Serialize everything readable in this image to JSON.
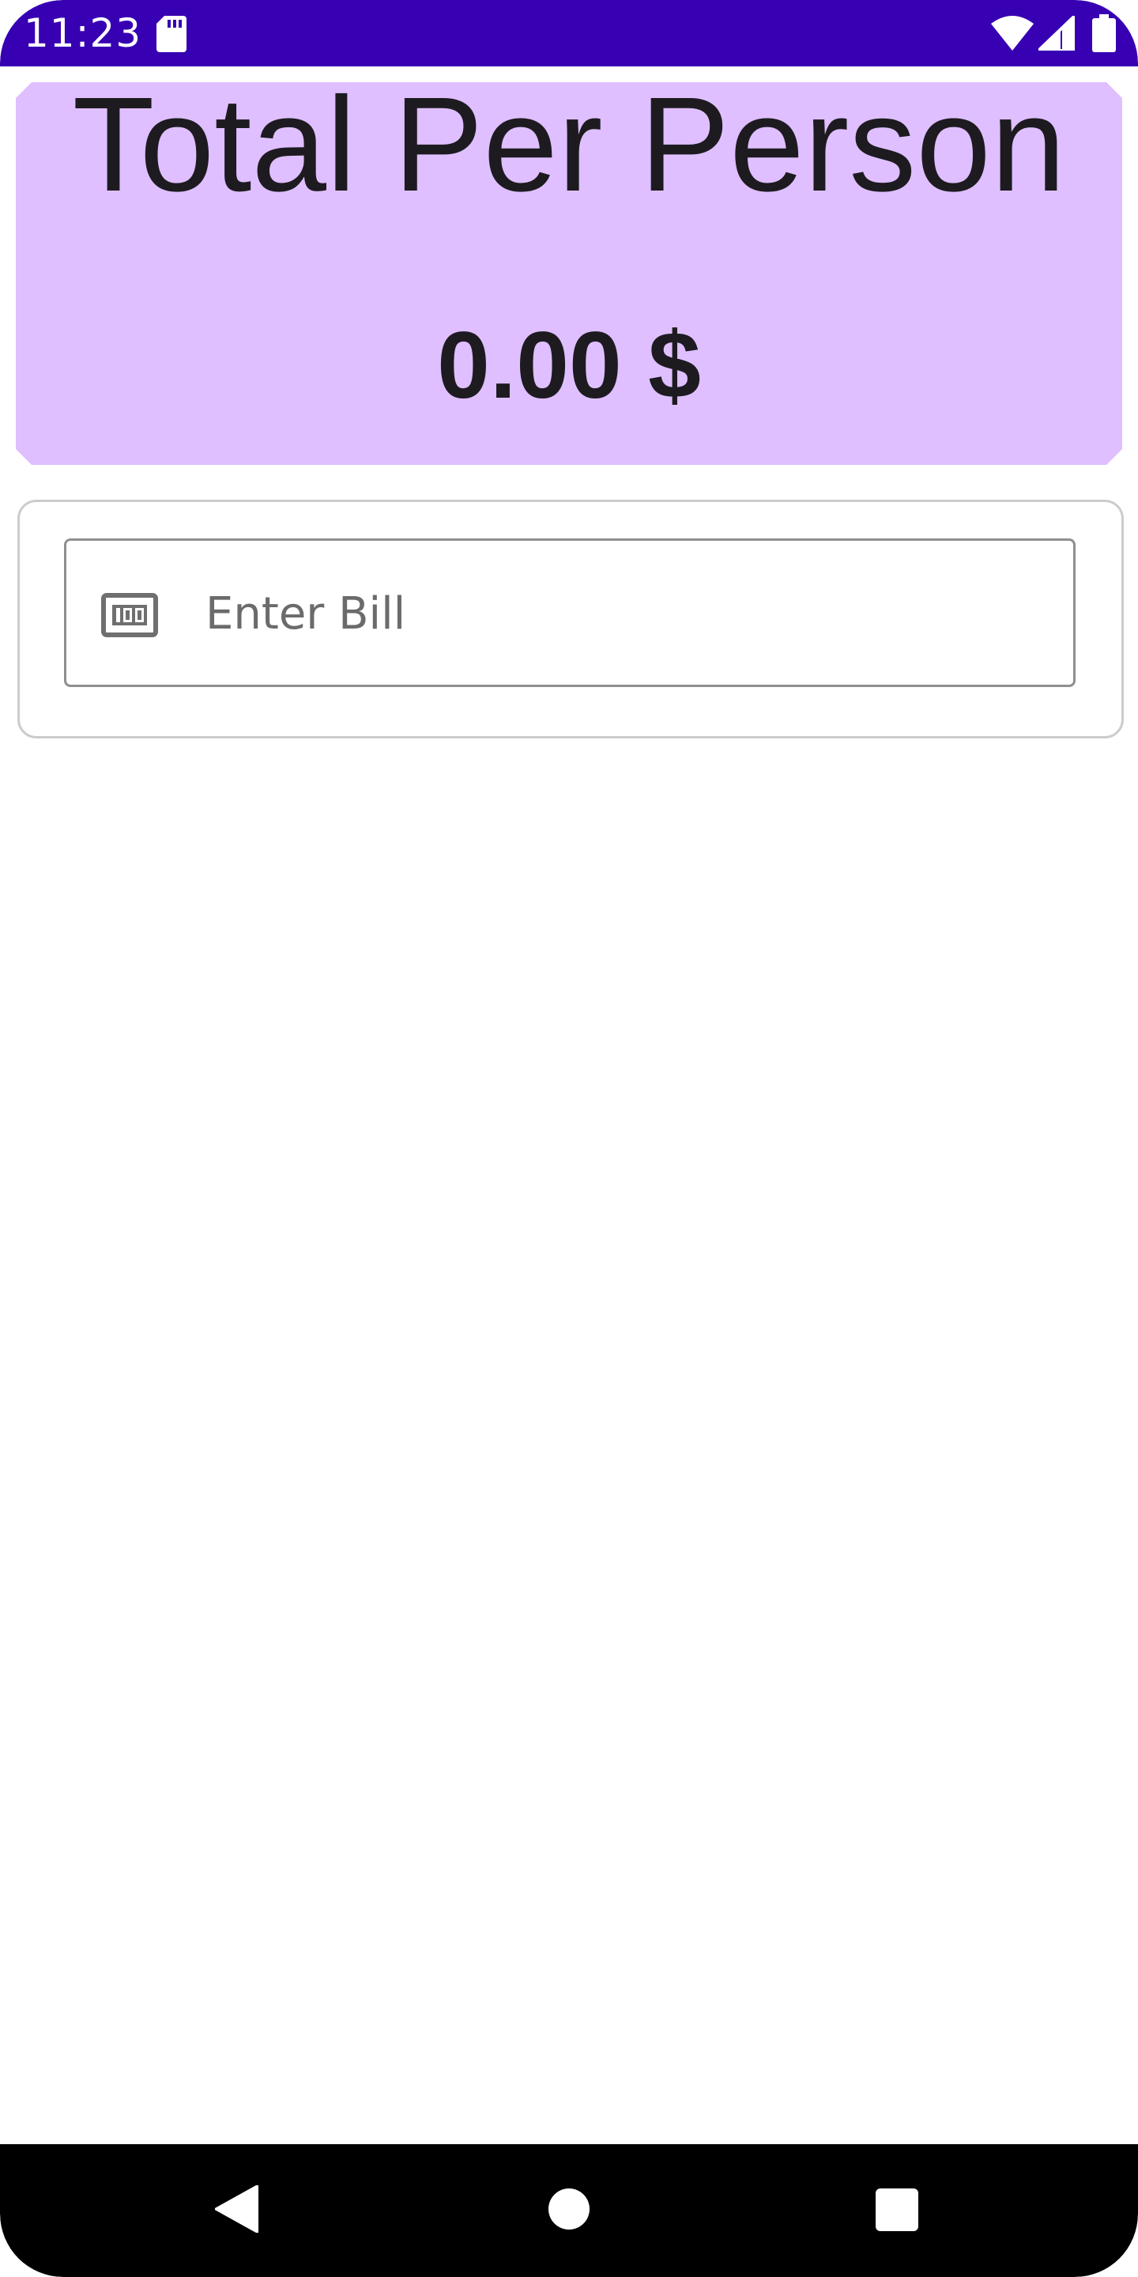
{
  "status_bar": {
    "time": "11:23",
    "icons": [
      "sd-card-icon",
      "wifi-icon",
      "signal-icon",
      "battery-icon"
    ],
    "background": "#3700b3"
  },
  "total_card": {
    "title": "Total Per Person",
    "amount": "0.00 $",
    "background": "#dfbfff"
  },
  "bill_form": {
    "bill_field": {
      "placeholder": "Enter Bill",
      "value": "",
      "icon": "money-icon"
    }
  },
  "nav_bar": {
    "icons": [
      "back-icon",
      "home-icon",
      "recents-icon"
    ]
  }
}
